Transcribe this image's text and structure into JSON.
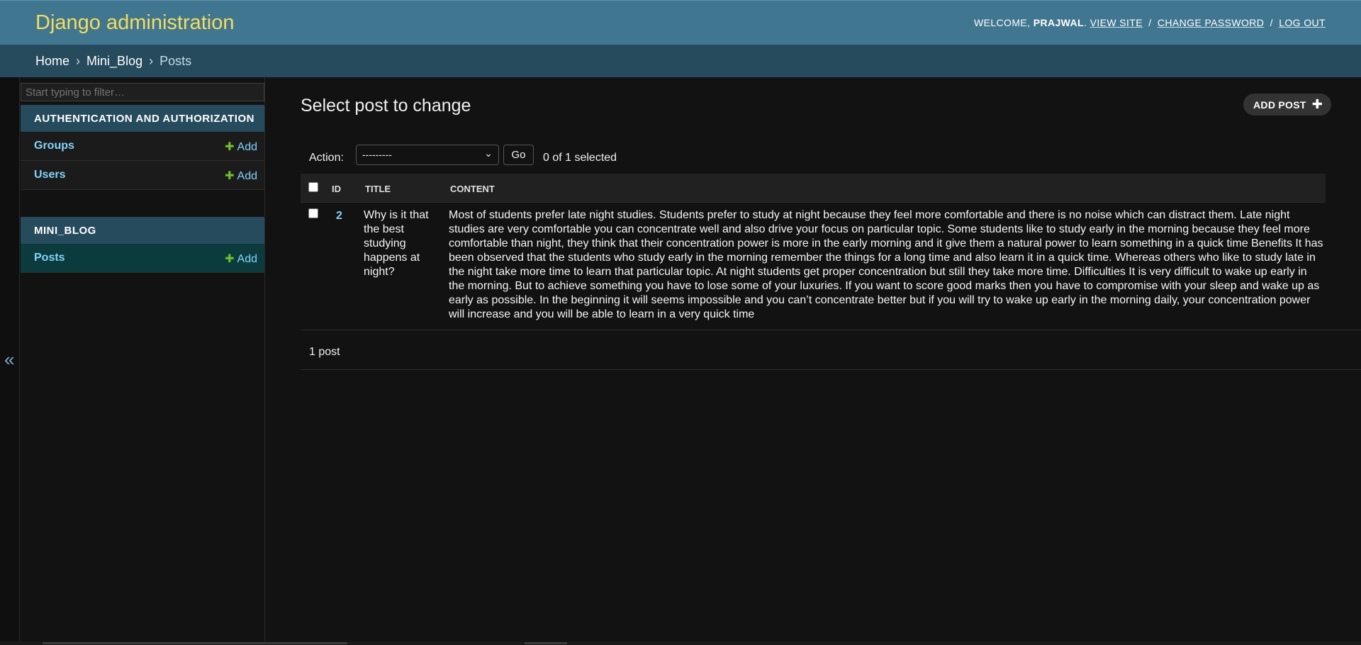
{
  "header": {
    "site_name": "Django administration",
    "welcome": "Welcome,",
    "username": "Prajwal",
    "view_site": "View site",
    "change_password": "Change password",
    "log_out": "Log out"
  },
  "breadcrumbs": {
    "home": "Home",
    "app": "Mini_Blog",
    "current": "Posts",
    "separator": "›"
  },
  "sidebar": {
    "filter_placeholder": "Start typing to filter…",
    "toggle_glyph": "«",
    "modules": [
      {
        "caption": "Authentication and Authorization",
        "models": [
          {
            "name": "Groups",
            "add_label": "Add"
          },
          {
            "name": "Users",
            "add_label": "Add"
          }
        ]
      },
      {
        "caption": "Mini_Blog",
        "models": [
          {
            "name": "Posts",
            "add_label": "Add"
          }
        ]
      }
    ]
  },
  "main": {
    "title": "Select post to change",
    "add_button": "Add post",
    "action_label": "Action:",
    "action_selected": "---------",
    "go_label": "Go",
    "selected_count": "0 of 1 selected",
    "columns": [
      "ID",
      "Title",
      "Content"
    ],
    "rows": [
      {
        "id": "2",
        "title": "Why is it that the best studying happens at night?",
        "content": "Most of students prefer late night studies. Students prefer to study at night because they feel more comfortable and there is no noise which can distract them. Late night studies are very comfortable you can concentrate well and also drive your focus on particular topic. Some students like to study early in the morning because they feel more comfortable than night, they think that their concentration power is more in the early morning and it give them a natural power to learn something in a quick time Benefits It has been observed that the students who study early in the morning remember the things for a long time and also learn it in a quick time. Whereas others who like to study late in the night take more time to learn that particular topic. At night students get proper concentration but still they take more time. Difficulties It is very difficult to wake up early in the morning. But to achieve something you have to lose some of your luxuries. If you want to score good marks then you have to compromise with your sleep and wake up as early as possible. In the beginning it will seems impossible and you can’t concentrate better but if you will try to wake up early in the morning daily, your concentration power will increase and you will be able to learn in a very quick time"
      }
    ],
    "paginator": "1 post"
  },
  "colors": {
    "header_bg": "#417690",
    "site_name": "#f5dd5d",
    "breadcrumb_bg": "#264b5d",
    "link": "#81d4fa",
    "add_plus": "#70bf2b",
    "current_model_bg": "#0b3b3d"
  }
}
